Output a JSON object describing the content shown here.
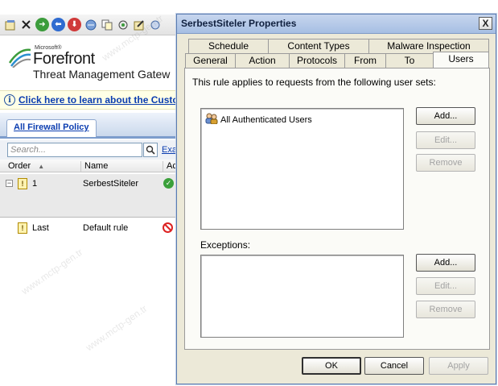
{
  "console": {
    "toolbar_icons": [
      "properties-icon",
      "delete-icon",
      "move-up-icon",
      "back-icon",
      "move-down-icon",
      "policy-icon",
      "copy-icon",
      "network-icon",
      "edit-icon",
      "settings-icon"
    ],
    "brand": {
      "microsoft": "Microsoft®",
      "forefront": "Forefront",
      "product": "Threat Management Gatew"
    },
    "infobar_link": "Click here to learn about the Custo",
    "policy_tab": "All Firewall Policy",
    "search_placeholder": "Search...",
    "search_more": "Exa",
    "columns": {
      "order": "Order",
      "name": "Name",
      "action": "Ac"
    },
    "rows": [
      {
        "order": "1",
        "name": "SerbestSiteler",
        "action": "allow"
      },
      {
        "order": "Last",
        "name": "Default rule",
        "action": "deny"
      }
    ]
  },
  "dialog": {
    "title": "SerbestSiteler Properties",
    "close_label": "X",
    "tabs_back": [
      "Schedule",
      "Content Types",
      "Malware Inspection"
    ],
    "tabs_front": [
      "General",
      "Action",
      "Protocols",
      "From",
      "To",
      "Users"
    ],
    "active_tab": "Users",
    "description": "This rule applies to requests from the following user sets:",
    "user_sets": [
      "All Authenticated Users"
    ],
    "exceptions_label": "Exceptions:",
    "buttons": {
      "add": "Add...",
      "edit": "Edit...",
      "remove": "Remove",
      "ok": "OK",
      "cancel": "Cancel",
      "apply": "Apply"
    }
  },
  "watermark": "www.mctp-gen.tr",
  "colors": {
    "dialog_bg": "#ece9d8",
    "link": "#0b3db0",
    "allow": "#3aa03a",
    "deny": "#d22222"
  }
}
